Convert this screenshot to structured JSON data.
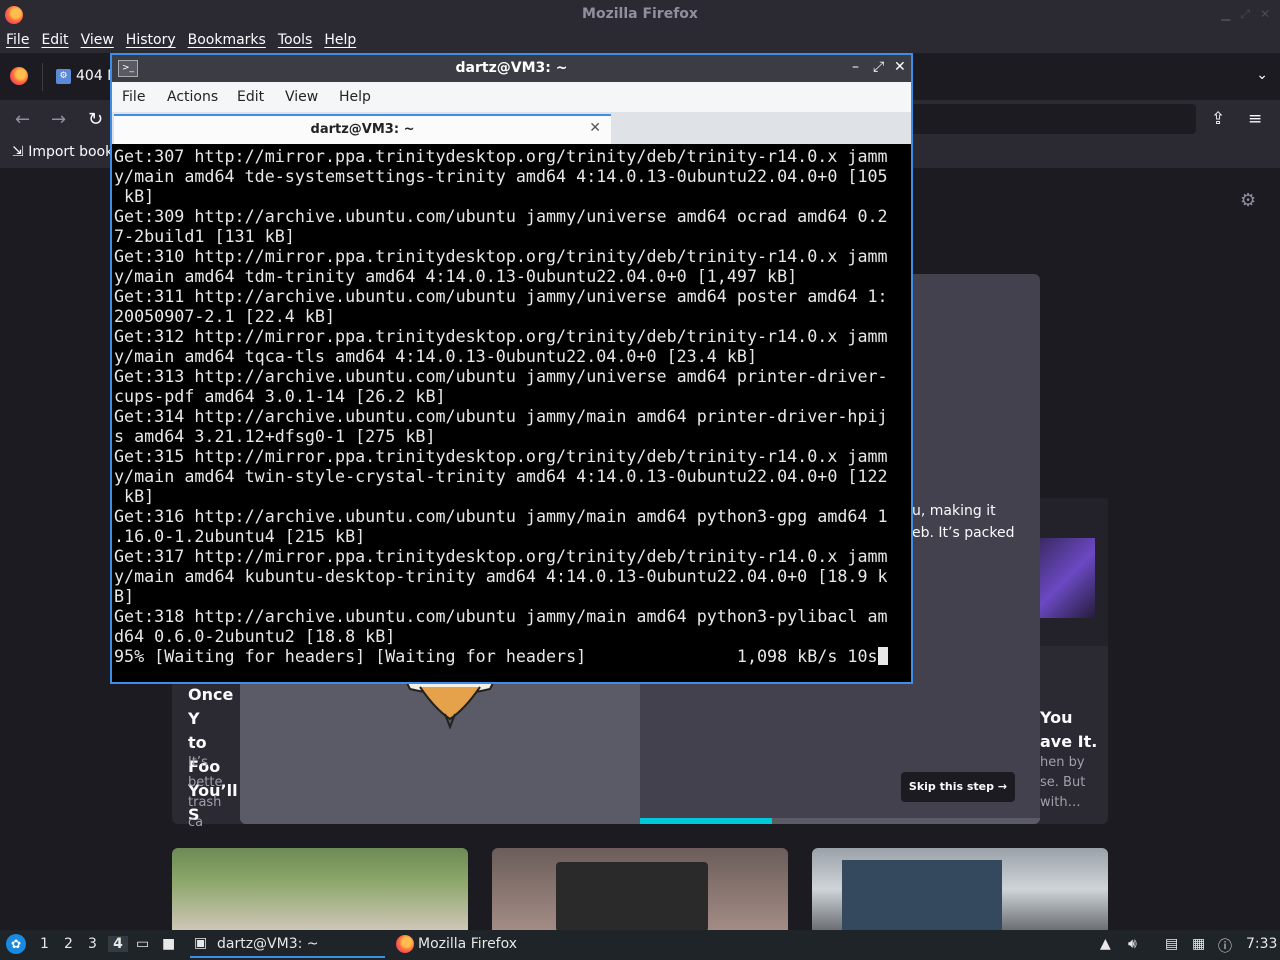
{
  "firefox": {
    "window_title": "Mozilla Firefox",
    "menu": [
      "File",
      "Edit",
      "View",
      "History",
      "Bookmarks",
      "Tools",
      "Help"
    ],
    "tab_label": "404 N",
    "import_bookmarks": "Import book",
    "onboarding": {
      "skip_label": "Skip this step →",
      "progress_fraction": 0.33,
      "right_text_1": "u, making it",
      "right_text_2": "eb. It’s packed",
      "left_title": [
        "Once Y",
        "to Foo",
        "You’ll S"
      ],
      "left_body": [
        "It’s bette",
        "trash ca"
      ],
      "right_title": [
        "You",
        "ave It."
      ],
      "right_body": [
        "hen by",
        "se. But",
        "with…"
      ]
    }
  },
  "terminal": {
    "window_title": "dartz@VM3: ~",
    "menu": [
      "File",
      "Actions",
      "Edit",
      "View",
      "Help"
    ],
    "tab_label": "dartz@VM3: ~",
    "lines": [
      "Get:307 http://mirror.ppa.trinitydesktop.org/trinity/deb/trinity-r14.0.x jamm",
      "y/main amd64 tde-systemsettings-trinity amd64 4:14.0.13-0ubuntu22.04.0+0 [105",
      " kB]",
      "Get:309 http://archive.ubuntu.com/ubuntu jammy/universe amd64 ocrad amd64 0.2",
      "7-2build1 [131 kB]",
      "Get:310 http://mirror.ppa.trinitydesktop.org/trinity/deb/trinity-r14.0.x jamm",
      "y/main amd64 tdm-trinity amd64 4:14.0.13-0ubuntu22.04.0+0 [1,497 kB]",
      "Get:311 http://archive.ubuntu.com/ubuntu jammy/universe amd64 poster amd64 1:",
      "20050907-2.1 [22.4 kB]",
      "Get:312 http://mirror.ppa.trinitydesktop.org/trinity/deb/trinity-r14.0.x jamm",
      "y/main amd64 tqca-tls amd64 4:14.0.13-0ubuntu22.04.0+0 [23.4 kB]",
      "Get:313 http://archive.ubuntu.com/ubuntu jammy/universe amd64 printer-driver-",
      "cups-pdf amd64 3.0.1-14 [26.2 kB]",
      "Get:314 http://archive.ubuntu.com/ubuntu jammy/main amd64 printer-driver-hpij",
      "s amd64 3.21.12+dfsg0-1 [275 kB]",
      "Get:315 http://mirror.ppa.trinitydesktop.org/trinity/deb/trinity-r14.0.x jamm",
      "y/main amd64 twin-style-crystal-trinity amd64 4:14.0.13-0ubuntu22.04.0+0 [122",
      " kB]",
      "Get:316 http://archive.ubuntu.com/ubuntu jammy/main amd64 python3-gpg amd64 1",
      ".16.0-1.2ubuntu4 [215 kB]",
      "Get:317 http://mirror.ppa.trinitydesktop.org/trinity/deb/trinity-r14.0.x jamm",
      "y/main amd64 kubuntu-desktop-trinity amd64 4:14.0.13-0ubuntu22.04.0+0 [18.9 k",
      "B]",
      "Get:318 http://archive.ubuntu.com/ubuntu jammy/main amd64 python3-pylibacl am",
      "d64 0.6.0-2ubuntu2 [18.8 kB]"
    ],
    "status_line": "95% [Waiting for headers] [Waiting for headers]               1,098 kB/s 10s"
  },
  "taskbar": {
    "workspaces": [
      "1",
      "2",
      "3",
      "4"
    ],
    "active_workspace": "4",
    "task_terminal": "dartz@VM3: ~",
    "task_firefox": "Mozilla Firefox",
    "clock": "7:33"
  },
  "colors": {
    "accent": "#3d8ee8",
    "progress": "#00c8d7"
  }
}
